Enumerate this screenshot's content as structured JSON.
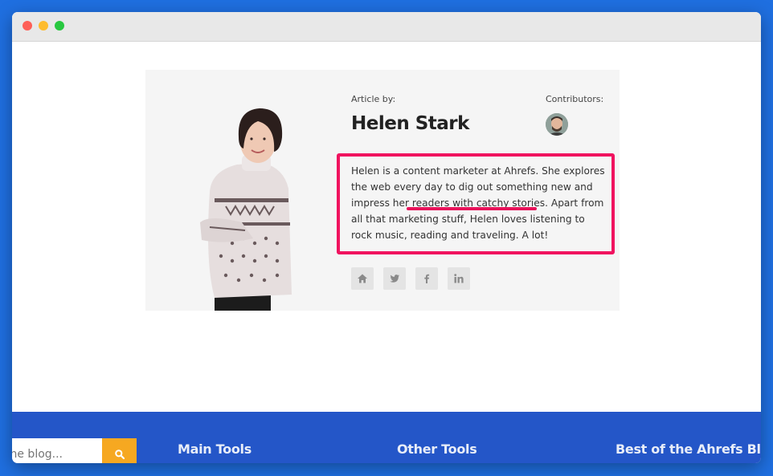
{
  "author": {
    "article_by_label": "Article by:",
    "name": "Helen Stark",
    "contributors_label": "Contributors:",
    "bio": "Helen is a content marketer at Ahrefs. She explores the web every day to dig out something new and impress her readers with catchy stories. Apart from all that marketing stuff, Helen loves listening to rock music, reading and traveling. A lot!"
  },
  "social": [
    "home-icon",
    "twitter-icon",
    "facebook-icon",
    "linkedin-icon"
  ],
  "footer": {
    "search_placeholder": "the blog...",
    "headings": [
      "Main Tools",
      "Other Tools",
      "Best of the Ahrefs Blog"
    ]
  },
  "colors": {
    "highlight_border": "#f0135f",
    "footer_bg": "#2456c8",
    "search_button": "#f6a821"
  }
}
